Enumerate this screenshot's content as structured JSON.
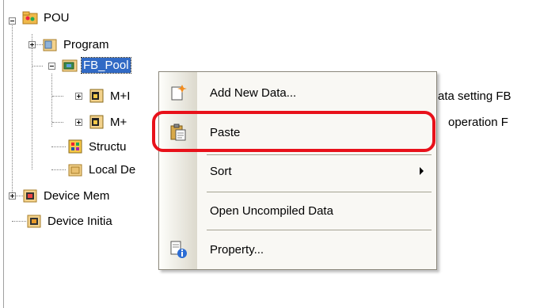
{
  "tree": {
    "root": "POU",
    "program": "Program",
    "fb_pool": "FB_Pool",
    "fb1": "M+I",
    "fb2": "M+",
    "fb1_tail": "ata setting FB",
    "fb2_tail": "operation F",
    "structured": "Structu",
    "local": "Local De",
    "device_memory": "Device Mem",
    "device_init": "Device Initia"
  },
  "context_menu": {
    "items": [
      {
        "label": "Add New Data...",
        "icon": "add-new-data-icon"
      },
      {
        "label": "Paste",
        "icon": "paste-icon"
      },
      {
        "label": "Sort",
        "icon": "",
        "submenu": true
      },
      {
        "label": "Open Uncompiled Data",
        "icon": ""
      },
      {
        "label": "Property...",
        "icon": "property-icon"
      }
    ]
  },
  "colors": {
    "selection": "#316ac5",
    "highlight_ring": "#e8111a",
    "menu_bg": "#f9f8f4"
  }
}
